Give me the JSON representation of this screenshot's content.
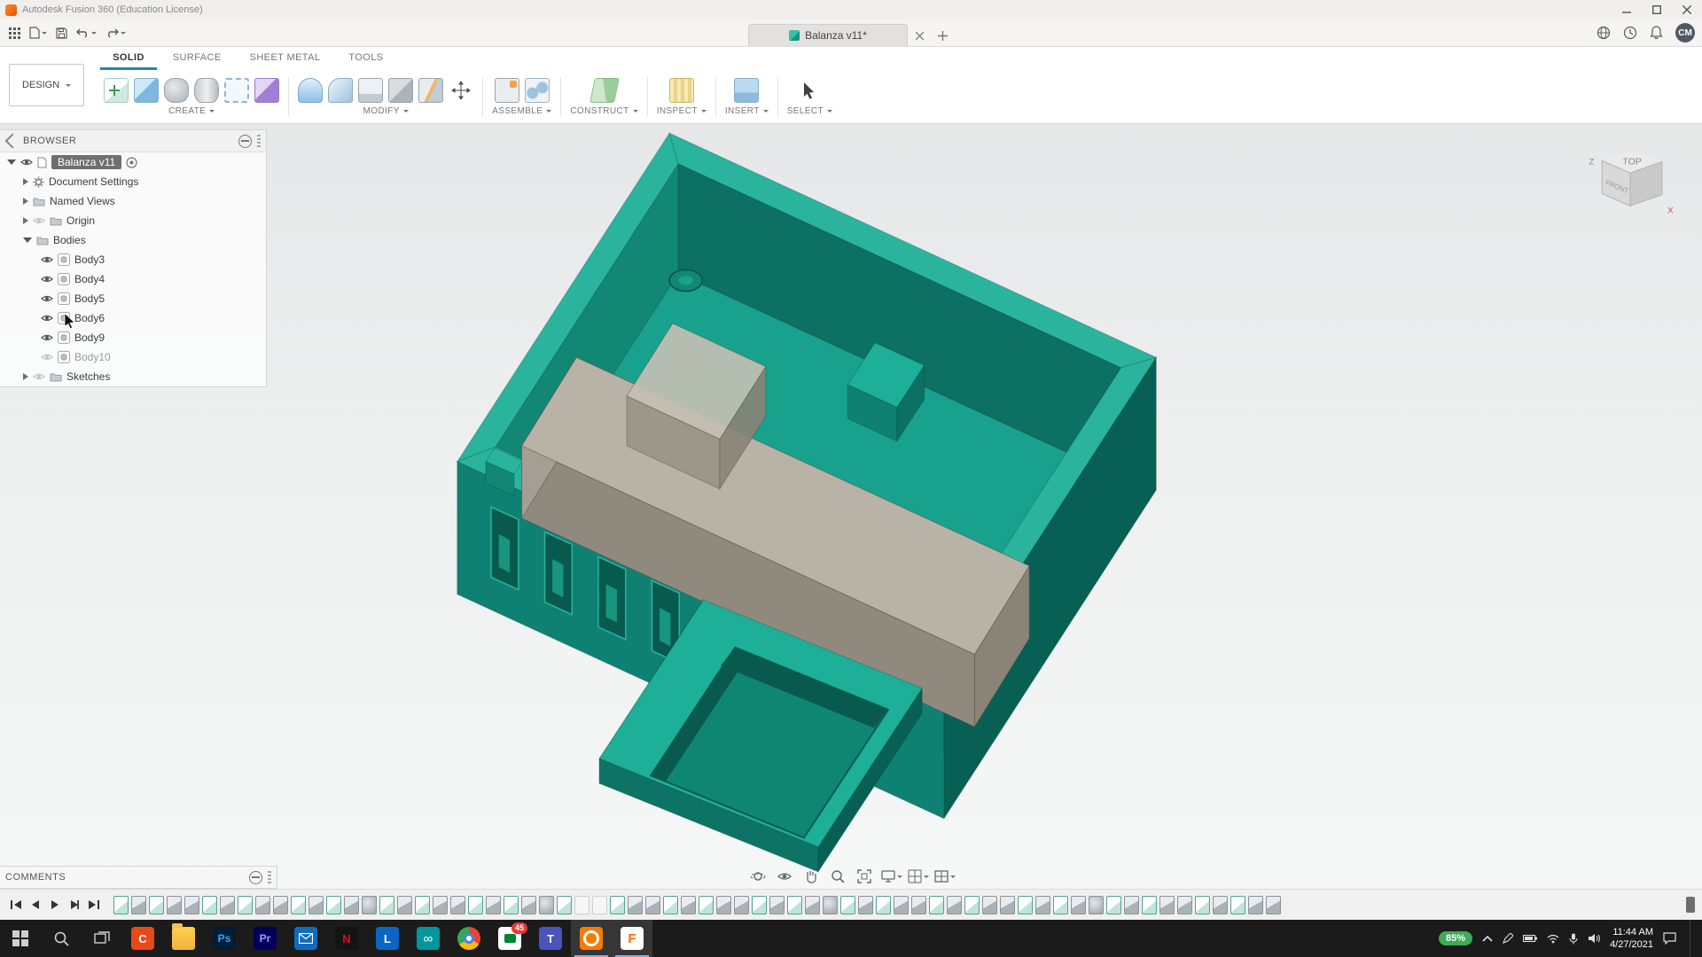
{
  "title_bar": {
    "title": "Autodesk Fusion 360 (Education License)"
  },
  "app_bar": {
    "document_tab": "Balanza v11*",
    "avatar_initials": "CM"
  },
  "ribbon": {
    "workspace": "DESIGN",
    "tabs": [
      {
        "label": "SOLID",
        "active": true
      },
      {
        "label": "SURFACE",
        "active": false
      },
      {
        "label": "SHEET METAL",
        "active": false
      },
      {
        "label": "TOOLS",
        "active": false
      }
    ],
    "groups": [
      {
        "label": "CREATE"
      },
      {
        "label": "MODIFY"
      },
      {
        "label": "ASSEMBLE"
      },
      {
        "label": "CONSTRUCT"
      },
      {
        "label": "INSPECT"
      },
      {
        "label": "INSERT"
      },
      {
        "label": "SELECT"
      }
    ]
  },
  "browser": {
    "header": "BROWSER",
    "items": [
      {
        "label": "Balanza v11",
        "type": "document",
        "expanded": true,
        "eye": "on",
        "selected": true
      },
      {
        "label": "Document Settings",
        "type": "settings",
        "expanded": false
      },
      {
        "label": "Named Views",
        "type": "folder",
        "expanded": false
      },
      {
        "label": "Origin",
        "type": "folder",
        "expanded": false,
        "eye": "off"
      },
      {
        "label": "Bodies",
        "type": "folder",
        "expanded": true
      },
      {
        "label": "Body3",
        "type": "body",
        "eye": "on"
      },
      {
        "label": "Body4",
        "type": "body",
        "eye": "on"
      },
      {
        "label": "Body5",
        "type": "body",
        "eye": "on"
      },
      {
        "label": "Body6",
        "type": "body",
        "eye": "on"
      },
      {
        "label": "Body9",
        "type": "body",
        "eye": "on"
      },
      {
        "label": "Body10",
        "type": "body",
        "eye": "off"
      },
      {
        "label": "Sketches",
        "type": "folder",
        "expanded": false,
        "eye": "off"
      }
    ]
  },
  "comments": {
    "header": "COMMENTS"
  },
  "viewcube": {
    "top": "TOP",
    "front": "FRONT",
    "axis_z": "Z",
    "axis_x": "X"
  },
  "nav_bar": {
    "icons": [
      "orbit",
      "look-at",
      "pan",
      "zoom",
      "fit",
      "display-settings",
      "grid-snaps",
      "viewports"
    ]
  },
  "timeline": {
    "items": [
      "sk",
      "ex",
      "sk",
      "ex",
      "ex",
      "sk",
      "ex",
      "sk",
      "ex",
      "ex",
      "sk",
      "ex",
      "sk",
      "ex",
      "fi",
      "sk",
      "ex",
      "sk",
      "ex",
      "ex",
      "sk",
      "ex",
      "sk",
      "ex",
      "fi",
      "sk",
      "su",
      "su",
      "sk",
      "ex",
      "ex",
      "sk",
      "ex",
      "sk",
      "ex",
      "ex",
      "sk",
      "ex",
      "sk",
      "ex",
      "fi",
      "sk",
      "ex",
      "sk",
      "ex",
      "ex",
      "sk",
      "ex",
      "sk",
      "ex",
      "ex",
      "sk",
      "ex",
      "sk",
      "ex",
      "fi",
      "sk",
      "ex",
      "sk",
      "ex",
      "ex",
      "sk",
      "ex",
      "sk",
      "ex",
      "ex"
    ]
  },
  "taskbar": {
    "apps": [
      {
        "name": "start"
      },
      {
        "name": "search"
      },
      {
        "name": "task-view"
      },
      {
        "name": "app-c",
        "label": "C"
      },
      {
        "name": "file-explorer"
      },
      {
        "name": "photoshop",
        "label": "Ps"
      },
      {
        "name": "premiere",
        "label": "Pr"
      },
      {
        "name": "mail"
      },
      {
        "name": "netflix",
        "label": "N"
      },
      {
        "name": "linkedin",
        "label": "L"
      },
      {
        "name": "arduino",
        "label": "∞"
      },
      {
        "name": "chrome"
      },
      {
        "name": "meet",
        "badge": "45"
      },
      {
        "name": "teams",
        "label": "T"
      },
      {
        "name": "app-orange",
        "active": true
      },
      {
        "name": "fusion360",
        "label": "F",
        "active": true
      }
    ],
    "tray": {
      "battery": "85%",
      "time": "11:44 AM",
      "date": "4/27/2021"
    }
  },
  "model": {
    "document_name": "Balanza v11",
    "colors": {
      "rim": "#2ab49e",
      "floor": "#18a28d",
      "innerL": "#128874",
      "innerR": "#0c7062",
      "outerFront": "#0f8173",
      "outerRight": "#086054",
      "shadow": "#085a4e",
      "slotTab": "#17957f",
      "compTop": "#1daf98",
      "compLeft": "#117e6d",
      "compFront": "#0d7365",
      "recess": "#0f8672",
      "beamTop": "#b9b3a7",
      "beamSide": "#908a7e",
      "beamEnd": "#a59f93",
      "boxTop": "#c6c0b4",
      "boxFront": "#9a9488",
      "boxRight": "#8a8478",
      "tab": "#a19b8f"
    }
  }
}
